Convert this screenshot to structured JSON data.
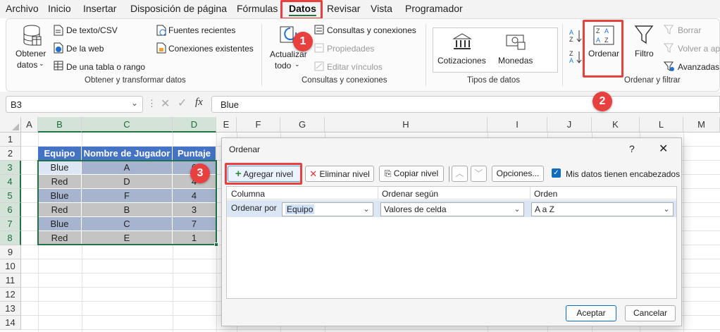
{
  "menu": {
    "items": [
      "Archivo",
      "Inicio",
      "Insertar",
      "Disposición de página",
      "Fórmulas",
      "Datos",
      "Revisar",
      "Vista",
      "Programador"
    ],
    "active": "Datos"
  },
  "ribbon": {
    "obtener": {
      "line1": "Obtener",
      "line2": "datos"
    },
    "de_texto": "De texto/CSV",
    "de_web": "De la web",
    "de_tabla": "De una tabla o rango",
    "fuentes": "Fuentes recientes",
    "conexiones_existentes": "Conexiones existentes",
    "group1": "Obtener y transformar datos",
    "actualizar": {
      "line1": "Actualizar",
      "line2": "todo"
    },
    "consultas": "Consultas y conexiones",
    "propiedades": "Propiedades",
    "editar": "Editar vínculos",
    "group2": "Consultas y conexiones",
    "cotizaciones": "Cotizaciones",
    "monedas": "Monedas",
    "group3": "Tipos de datos",
    "ordenar": "Ordenar",
    "filtro": "Filtro",
    "borrar": "Borrar",
    "volver": "Volver a apl",
    "avanzadas": "Avanzadas",
    "group4": "Ordenar y filtrar"
  },
  "formula_bar": {
    "name_box": "B3",
    "fx": "fx",
    "value": "Blue"
  },
  "columns": [
    "A",
    "B",
    "C",
    "D",
    "E",
    "F",
    "G",
    "H",
    "I",
    "J",
    "K",
    "L",
    "M"
  ],
  "rows": [
    "1",
    "2",
    "3",
    "4",
    "5",
    "6",
    "7",
    "8",
    "9",
    "10",
    "11",
    "12",
    "13",
    "14"
  ],
  "table": {
    "headers": [
      "Equipo",
      "Nombre de Jugador",
      "Puntaje"
    ],
    "rows": [
      [
        "Blue",
        "A",
        "6"
      ],
      [
        "Red",
        "D",
        "4"
      ],
      [
        "Blue",
        "F",
        "4"
      ],
      [
        "Red",
        "B",
        "3"
      ],
      [
        "Blue",
        "C",
        "7"
      ],
      [
        "Red",
        "E",
        "1"
      ]
    ]
  },
  "dialog": {
    "title": "Ordenar",
    "help": "?",
    "close": "✕",
    "add_level": "Agregar nivel",
    "delete_level": "Eliminar nivel",
    "copy_level": "Copiar nivel",
    "options": "Opciones...",
    "headers_checkbox": "Mis datos tienen encabezados",
    "col_header": "Columna",
    "sort_on_header": "Ordenar según",
    "order_header": "Orden",
    "row_label": "Ordenar por",
    "column_value": "Equipo",
    "sort_on_value": "Valores de celda",
    "order_value": "A a Z",
    "accept": "Aceptar",
    "cancel": "Cancelar"
  },
  "badges": [
    "1",
    "2",
    "3"
  ],
  "colors": {
    "accent": "#217346",
    "badge": "#e8403e",
    "table_header": "#4472c4",
    "checkbox": "#0f6cbd"
  }
}
